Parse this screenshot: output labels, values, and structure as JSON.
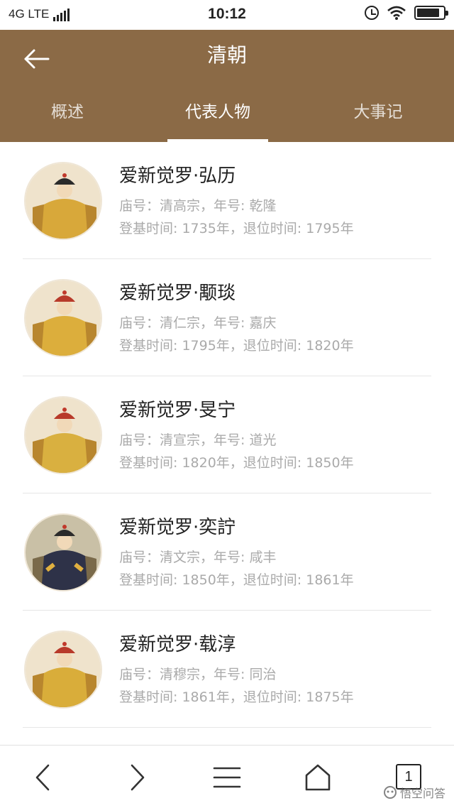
{
  "status_bar": {
    "network": "4G LTE",
    "time": "10:12",
    "battery_level": 0.85
  },
  "header": {
    "title": "清朝",
    "back_icon": "arrow-left-icon"
  },
  "tabs": [
    {
      "label": "概述",
      "active": false
    },
    {
      "label": "代表人物",
      "active": true
    },
    {
      "label": "大事记",
      "active": false
    }
  ],
  "emperors": [
    {
      "name": "爱新觉罗·弘历",
      "line1": "庙号：清高宗，年号: 乾隆",
      "line2": "登基时间: 1735年，退位时间: 1795年",
      "robe_color": "#d8a83a",
      "hat_color": "#2b2b2b"
    },
    {
      "name": "爱新觉罗·颙琰",
      "line1": "庙号：清仁宗，年号: 嘉庆",
      "line2": "登基时间: 1795年，退位时间: 1820年",
      "robe_color": "#dcae3c",
      "hat_color": "#b83a2a"
    },
    {
      "name": "爱新觉罗·旻宁",
      "line1": "庙号：清宣宗，年号: 道光",
      "line2": "登基时间: 1820年，退位时间: 1850年",
      "robe_color": "#d9b040",
      "hat_color": "#b83a2a"
    },
    {
      "name": "爱新觉罗·奕詝",
      "line1": "庙号：清文宗，年号: 咸丰",
      "line2": "登基时间: 1850年，退位时间: 1861年",
      "robe_color": "#2e3248",
      "hat_color": "#2b2b2b"
    },
    {
      "name": "爱新觉罗·载淳",
      "line1": "庙号：清穆宗，年号: 同治",
      "line2": "登基时间: 1861年，退位时间: 1875年",
      "robe_color": "#d9ad3a",
      "hat_color": "#b83a2a"
    }
  ],
  "bottom_nav": {
    "tab_count": "1",
    "icons": [
      "back-icon",
      "forward-icon",
      "menu-icon",
      "home-icon",
      "tabs-icon"
    ]
  },
  "watermark": "悟空问答"
}
